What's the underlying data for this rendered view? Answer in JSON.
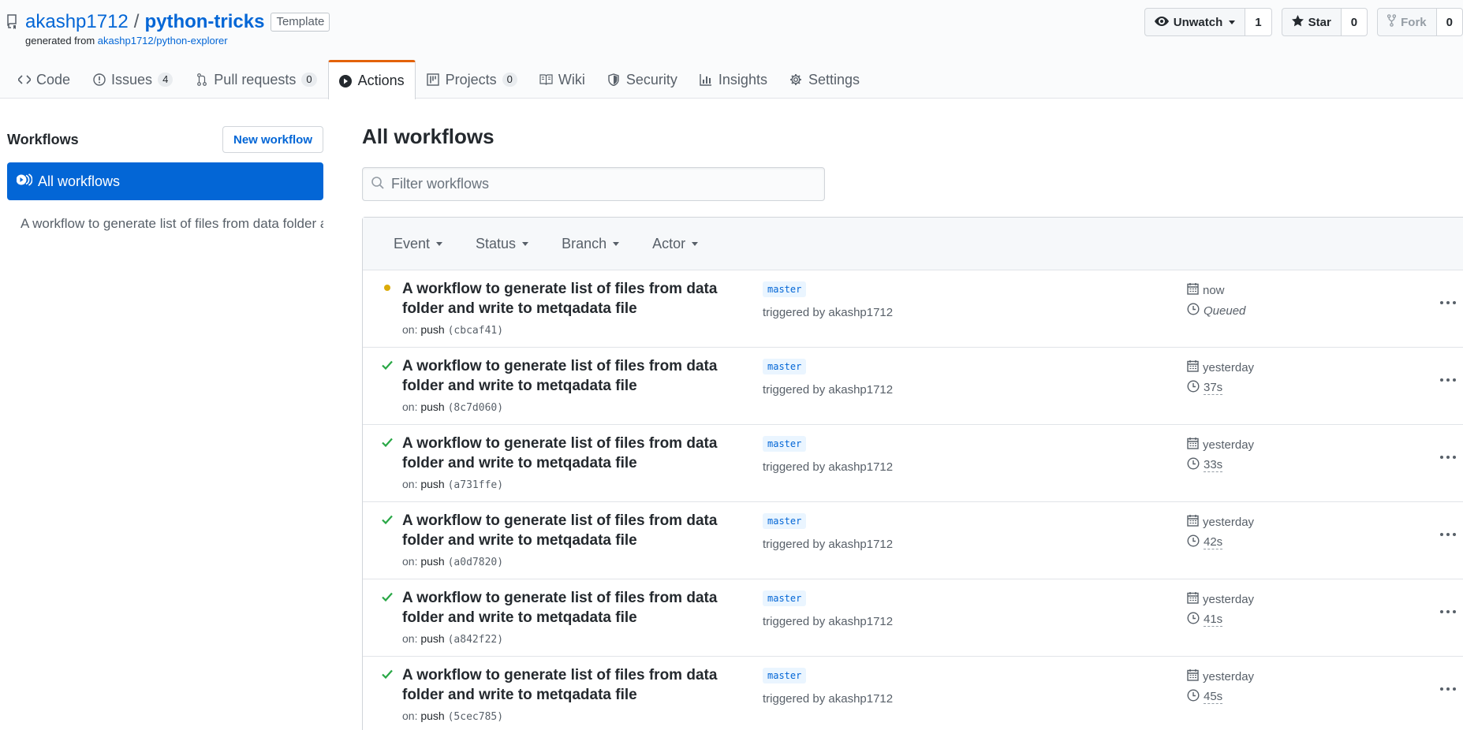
{
  "repo": {
    "owner": "akashp1712",
    "slash": "/",
    "name": "python-tricks",
    "badge": "Template",
    "generated_prefix": "generated from",
    "generated_from": "akashp1712/python-explorer"
  },
  "actions": {
    "watch_label": "Unwatch",
    "watch_count": "1",
    "star_label": "Star",
    "star_count": "0",
    "fork_label": "Fork",
    "fork_count": "0"
  },
  "nav": {
    "code": "Code",
    "issues": "Issues",
    "issues_count": "4",
    "pulls": "Pull requests",
    "pulls_count": "0",
    "actions": "Actions",
    "projects": "Projects",
    "projects_count": "0",
    "wiki": "Wiki",
    "security": "Security",
    "insights": "Insights",
    "settings": "Settings"
  },
  "sidebar": {
    "title": "Workflows",
    "new_button": "New workflow",
    "all_label": "All workflows",
    "workflow_item": "A workflow to generate list of files from data folder and write to metqadata file"
  },
  "main": {
    "title": "All workflows",
    "filter_placeholder": "Filter workflows",
    "filters": [
      "Event",
      "Status",
      "Branch",
      "Actor"
    ]
  },
  "runs": [
    {
      "status": "queued",
      "title": "A workflow to generate list of files from data folder and write to metqadata file",
      "on": "on:",
      "event": "push",
      "sha": "(cbcaf41)",
      "branch": "master",
      "trigger": "triggered by akashp1712",
      "when": "now",
      "duration": "Queued"
    },
    {
      "status": "success",
      "title": "A workflow to generate list of files from data folder and write to metqadata file",
      "on": "on:",
      "event": "push",
      "sha": "(8c7d060)",
      "branch": "master",
      "trigger": "triggered by akashp1712",
      "when": "yesterday",
      "duration": "37s"
    },
    {
      "status": "success",
      "title": "A workflow to generate list of files from data folder and write to metqadata file",
      "on": "on:",
      "event": "push",
      "sha": "(a731ffe)",
      "branch": "master",
      "trigger": "triggered by akashp1712",
      "when": "yesterday",
      "duration": "33s"
    },
    {
      "status": "success",
      "title": "A workflow to generate list of files from data folder and write to metqadata file",
      "on": "on:",
      "event": "push",
      "sha": "(a0d7820)",
      "branch": "master",
      "trigger": "triggered by akashp1712",
      "when": "yesterday",
      "duration": "42s"
    },
    {
      "status": "success",
      "title": "A workflow to generate list of files from data folder and write to metqadata file",
      "on": "on:",
      "event": "push",
      "sha": "(a842f22)",
      "branch": "master",
      "trigger": "triggered by akashp1712",
      "when": "yesterday",
      "duration": "41s"
    },
    {
      "status": "success",
      "title": "A workflow to generate list of files from data folder and write to metqadata file",
      "on": "on:",
      "event": "push",
      "sha": "(5cec785)",
      "branch": "master",
      "trigger": "triggered by akashp1712",
      "when": "yesterday",
      "duration": "45s"
    }
  ],
  "colors": {
    "link": "#0366d6",
    "selected_tab_accent": "#e36209",
    "success": "#28a745",
    "queued": "#dbab09"
  }
}
